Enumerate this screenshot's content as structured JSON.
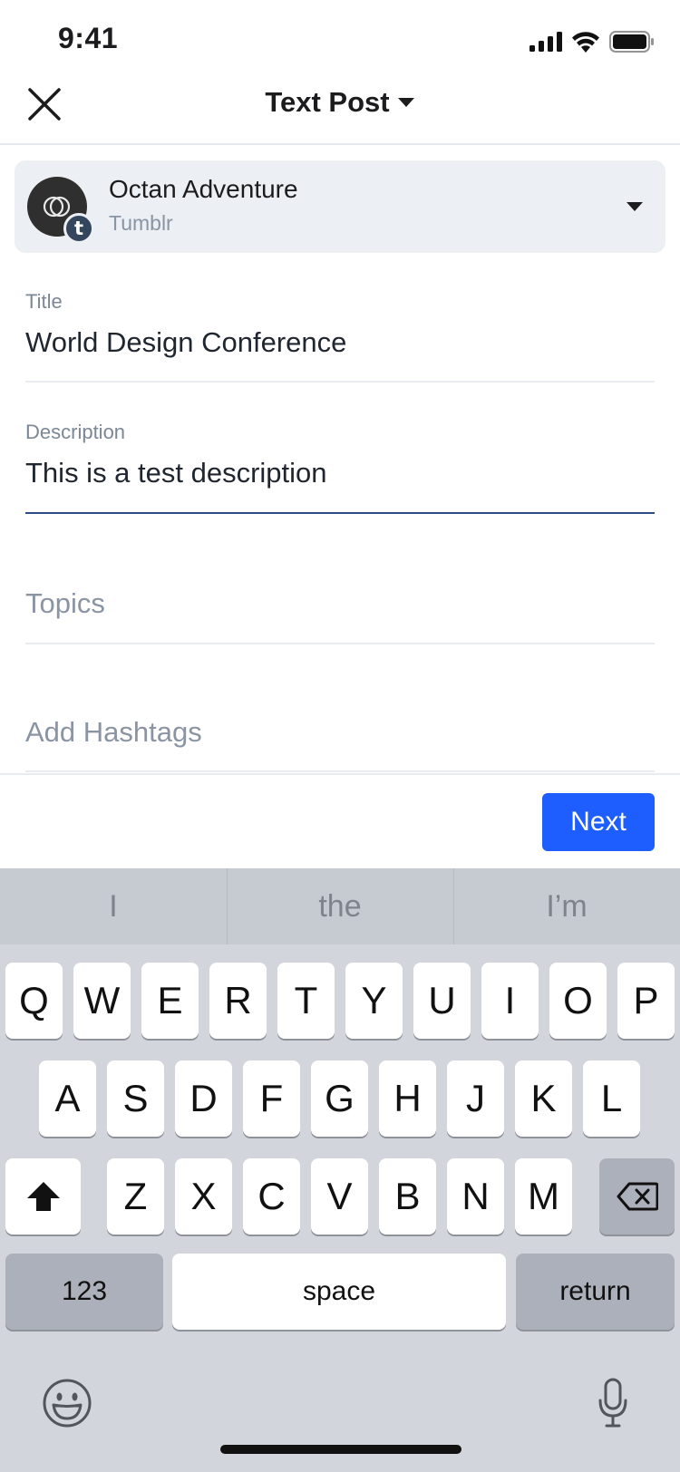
{
  "status_bar": {
    "time": "9:41"
  },
  "header": {
    "title": "Text Post"
  },
  "account": {
    "name": "Octan Adventure",
    "network": "Tumblr",
    "badge_letter": "t"
  },
  "form": {
    "title_label": "Title",
    "title_value": "World Design Conference",
    "description_label": "Description",
    "description_value": "This is a test description",
    "topics_placeholder": "Topics",
    "hashtags_placeholder": "Add Hashtags"
  },
  "toolbar": {
    "next_label": "Next"
  },
  "keyboard": {
    "suggestions": [
      "I",
      "the",
      "I’m"
    ],
    "row1": [
      "Q",
      "W",
      "E",
      "R",
      "T",
      "Y",
      "U",
      "I",
      "O",
      "P"
    ],
    "row2": [
      "A",
      "S",
      "D",
      "F",
      "G",
      "H",
      "J",
      "K",
      "L"
    ],
    "row3": [
      "Z",
      "X",
      "C",
      "V",
      "B",
      "N",
      "M"
    ],
    "numbers_label": "123",
    "space_label": "space",
    "return_label": "return"
  },
  "colors": {
    "accent": "#1e5eff",
    "active_underline": "#2b4c8c",
    "tumblr_badge": "#34465d",
    "card_bg": "#eceff3"
  },
  "icons": [
    "close-icon",
    "caret-down-icon",
    "signal-icon",
    "wifi-icon",
    "battery-icon",
    "shift-icon",
    "backspace-icon",
    "emoji-icon",
    "microphone-icon"
  ]
}
